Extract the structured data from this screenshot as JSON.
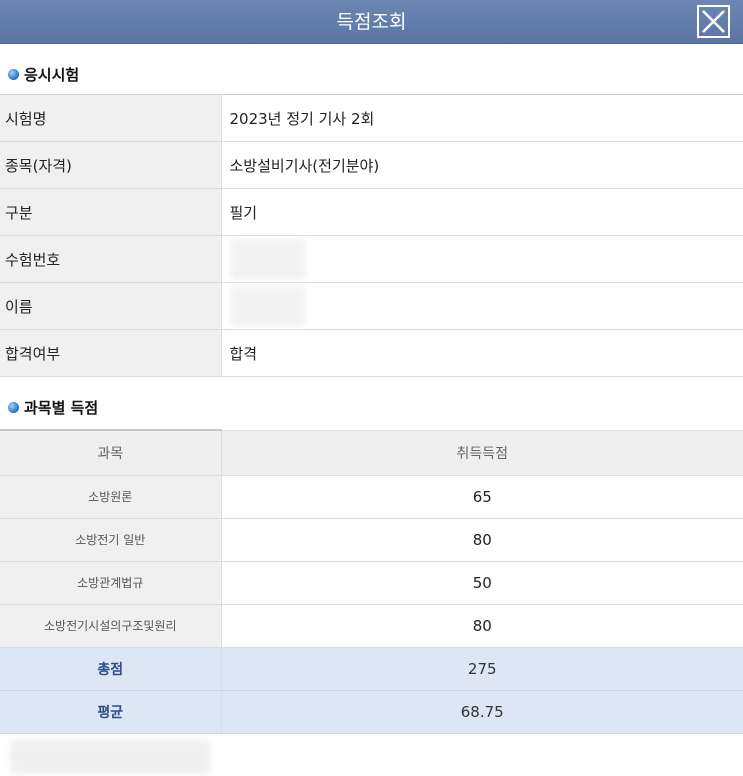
{
  "window": {
    "title": "득점조회",
    "close_icon": "close-icon"
  },
  "exam_section": {
    "heading": "응시시험",
    "rows": [
      {
        "label": "시험명",
        "value": "2023년 정기 기사 2회"
      },
      {
        "label": "종목(자격)",
        "value": "소방설비기사(전기분야)"
      },
      {
        "label": "구분",
        "value": "필기"
      },
      {
        "label": "수험번호",
        "value": ""
      },
      {
        "label": "이름",
        "value": ""
      },
      {
        "label": "합격여부",
        "value": "합격"
      }
    ]
  },
  "score_section": {
    "heading": "과목별 득점",
    "columns": [
      "과목",
      "취득득점"
    ],
    "subjects": [
      {
        "name": "소방원론",
        "score": "65"
      },
      {
        "name": "소방전기 일반",
        "score": "80"
      },
      {
        "name": "소방관계법규",
        "score": "50"
      },
      {
        "name": "소방전기시설의구조및원리",
        "score": "80"
      }
    ],
    "total": {
      "label": "총점",
      "value": "275"
    },
    "average": {
      "label": "평균",
      "value": "68.75"
    }
  },
  "colors": {
    "titlebar": "#5f7aa9",
    "summary_row": "#dde6f5",
    "summary_label": "#2d4e86",
    "bullet": "#1e6fc4"
  }
}
